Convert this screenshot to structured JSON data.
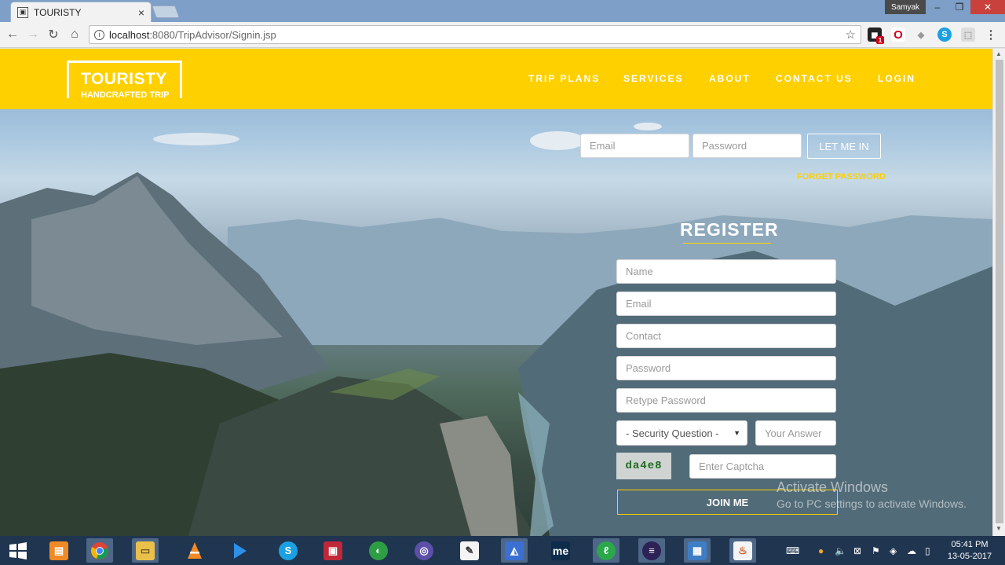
{
  "browser": {
    "tab_title": "TOURISTY",
    "tab_close": "×",
    "user_name": "Samyak",
    "url_host": "localhost",
    "url_rest": ":8080/TripAdvisor/Signin.jsp",
    "extension_badge": "1"
  },
  "site": {
    "brand": "TOURISTY",
    "tagline": "HANDCRAFTED TRIP",
    "nav": [
      "TRIP PLANS",
      "SERVICES",
      "ABOUT",
      "CONTACT US",
      "LOGIN"
    ]
  },
  "login": {
    "email_placeholder": "Email",
    "password_placeholder": "Password",
    "submit_label": "LET ME IN",
    "forgot_label": "FORGET PASSWORD"
  },
  "register": {
    "heading": "REGISTER",
    "name_placeholder": "Name",
    "email_placeholder": "Email",
    "contact_placeholder": "Contact",
    "password_placeholder": "Password",
    "retype_placeholder": "Retype Password",
    "security_question": "- Security Question -",
    "answer_placeholder": "Your Answer",
    "captcha_text": "da4e8",
    "captcha_placeholder": "Enter Captcha",
    "submit_label": "JOIN ME"
  },
  "watermark": {
    "title": "Activate Windows",
    "subtitle": "Go to PC settings to activate Windows."
  },
  "taskbar": {
    "time": "05:41 PM",
    "date": "13-05-2017"
  },
  "colors": {
    "brand_yellow": "#ffd000",
    "taskbar": "#1f3550",
    "chrome_frame": "#7e9fc7"
  }
}
